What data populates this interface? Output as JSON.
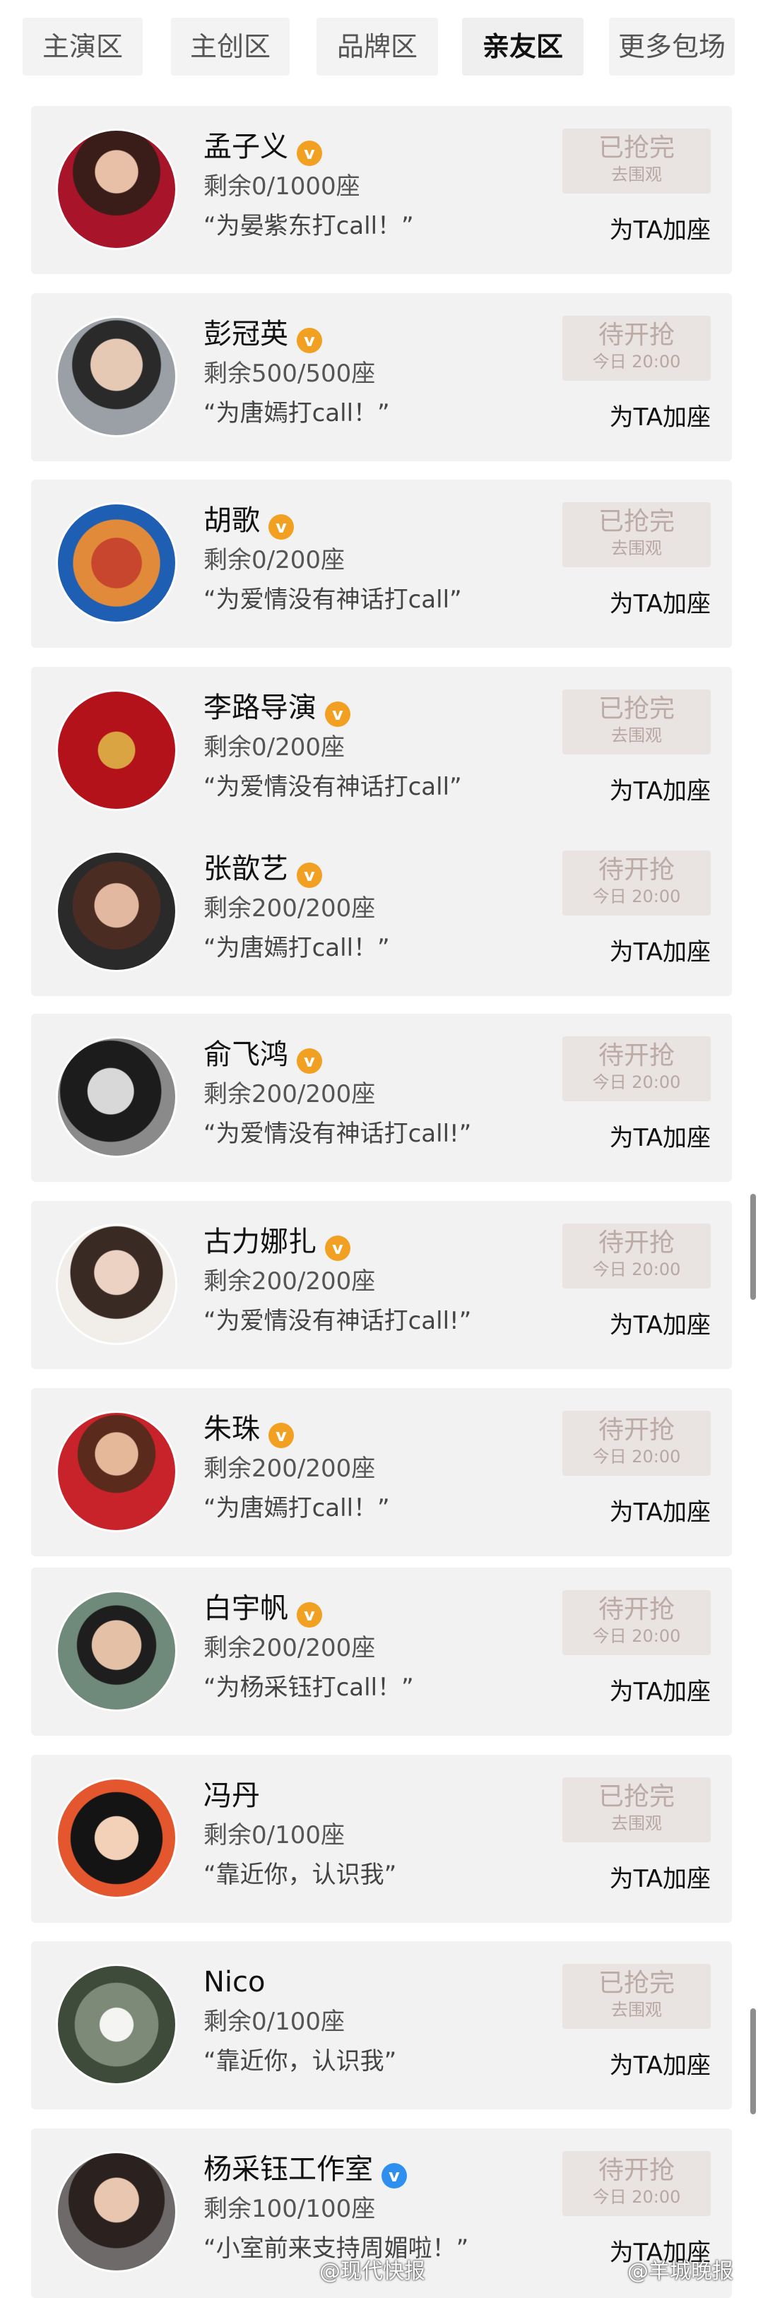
{
  "tabs": [
    {
      "label": "主演区",
      "active": false
    },
    {
      "label": "主创区",
      "active": false
    },
    {
      "label": "品牌区",
      "active": false
    },
    {
      "label": "亲友区",
      "active": true
    },
    {
      "label": "更多包场",
      "active": false
    }
  ],
  "entries": [
    {
      "name": "孟子义",
      "seats": "剩余0/1000座",
      "slogan": "“为晏紫东打call！”",
      "status": "已抢完",
      "status_sub": "去围观",
      "verified": "orange",
      "add_label": "为TA加座"
    },
    {
      "name": "彭冠英",
      "seats": "剩余500/500座",
      "slogan": "“为唐嫣打call！”",
      "status": "待开抢",
      "status_sub": "今日 20:00",
      "verified": "orange",
      "add_label": "为TA加座"
    },
    {
      "name": "胡歌",
      "seats": "剩余0/200座",
      "slogan": "“为爱情没有神话打call”",
      "status": "已抢完",
      "status_sub": "去围观",
      "verified": "orange",
      "add_label": "为TA加座"
    },
    {
      "name": "李路导演",
      "seats": "剩余0/200座",
      "slogan": "“为爱情没有神话打call”",
      "status": "已抢完",
      "status_sub": "去围观",
      "verified": "orange",
      "add_label": "为TA加座"
    },
    {
      "name": "张歆艺",
      "seats": "剩余200/200座",
      "slogan": "“为唐嫣打call！”",
      "status": "待开抢",
      "status_sub": "今日 20:00",
      "verified": "orange",
      "add_label": "为TA加座"
    },
    {
      "name": "俞飞鸿",
      "seats": "剩余200/200座",
      "slogan": "“为爱情没有神话打call!”",
      "status": "待开抢",
      "status_sub": "今日 20:00",
      "verified": "orange",
      "add_label": "为TA加座"
    },
    {
      "name": "古力娜扎",
      "seats": "剩余200/200座",
      "slogan": "“为爱情没有神话打call!”",
      "status": "待开抢",
      "status_sub": "今日 20:00",
      "verified": "orange",
      "add_label": "为TA加座"
    },
    {
      "name": "朱珠",
      "seats": "剩余200/200座",
      "slogan": "“为唐嫣打call！”",
      "status": "待开抢",
      "status_sub": "今日 20:00",
      "verified": "orange",
      "add_label": "为TA加座"
    },
    {
      "name": "白宇帆",
      "seats": "剩余200/200座",
      "slogan": "“为杨采钰打call！”",
      "status": "待开抢",
      "status_sub": "今日 20:00",
      "verified": "orange",
      "add_label": "为TA加座"
    },
    {
      "name": "冯丹",
      "seats": "剩余0/100座",
      "slogan": "“靠近你，认识我”",
      "status": "已抢完",
      "status_sub": "去围观",
      "verified": "",
      "add_label": "为TA加座"
    },
    {
      "name": "Nico",
      "seats": "剩余0/100座",
      "slogan": "“靠近你，认识我”",
      "status": "已抢完",
      "status_sub": "去围观",
      "verified": "",
      "add_label": "为TA加座"
    },
    {
      "name": "杨采钰工作室",
      "seats": "剩余100/100座",
      "slogan": "“小室前来支持周媚啦！”",
      "status": "待开抢",
      "status_sub": "今日 20:00",
      "verified": "blue",
      "add_label": "为TA加座"
    }
  ],
  "watermarks": [
    "@现代快报",
    "@羊城晚报"
  ],
  "colors": {
    "card_bg": "#f2f2f2",
    "status_bg": "#e9e3e1",
    "status_text": "#bcaaa5",
    "verified_orange": "#f2a021",
    "verified_blue": "#2e8fef"
  }
}
